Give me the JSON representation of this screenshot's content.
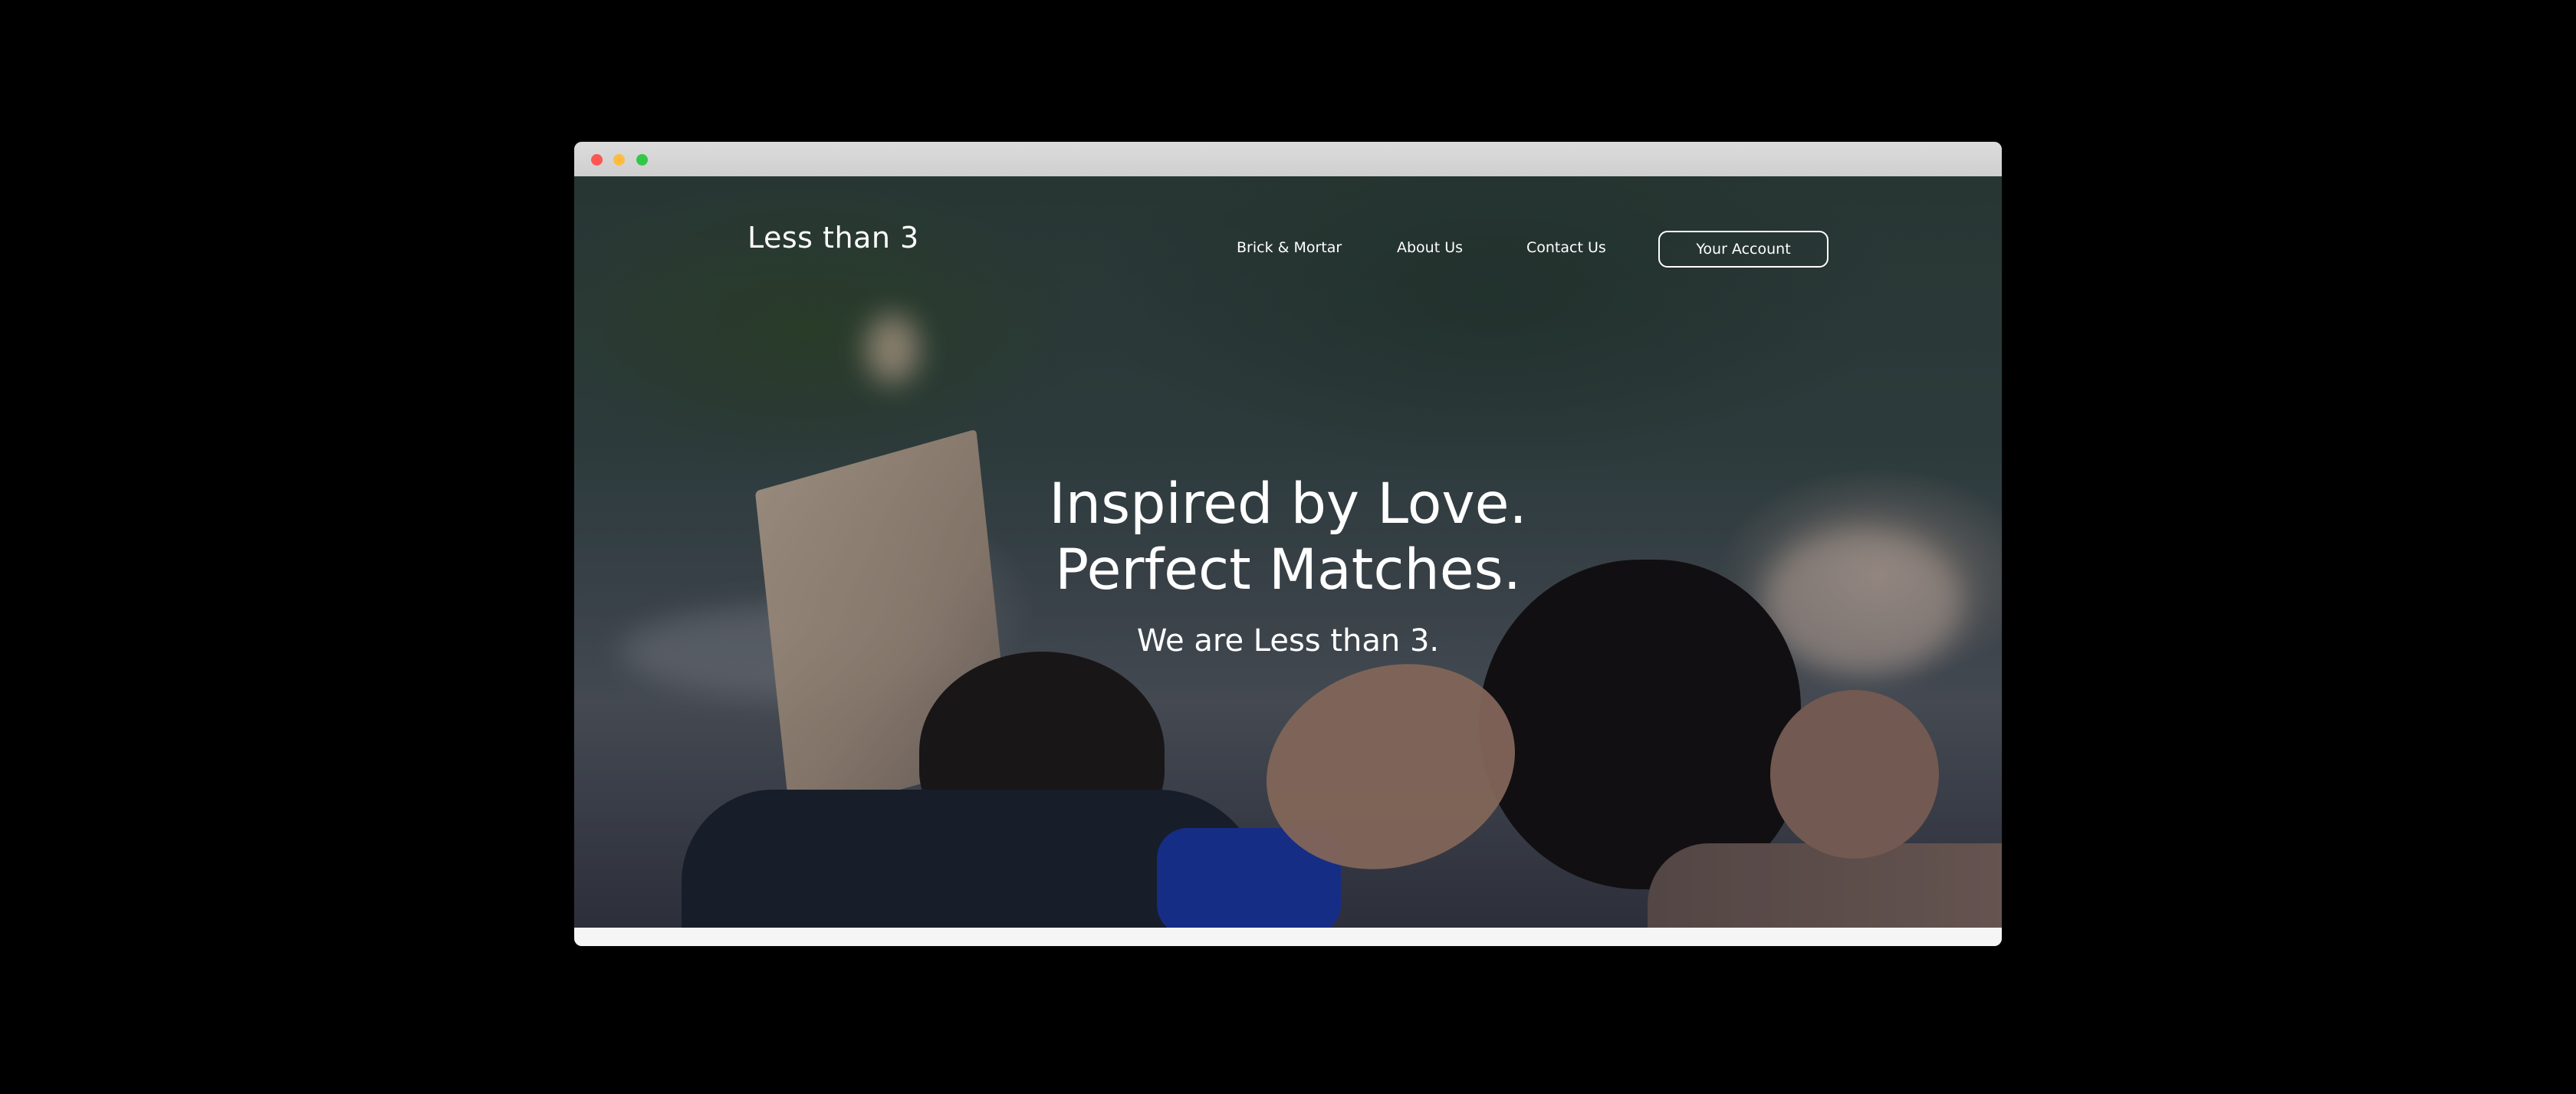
{
  "brand": {
    "name": "Less than 3"
  },
  "nav": {
    "links": [
      {
        "label": "Brick & Mortar"
      },
      {
        "label": "About Us"
      },
      {
        "label": "Contact Us"
      }
    ],
    "account_label": "Your Account"
  },
  "hero": {
    "headline_line1": "Inspired by Love.",
    "headline_line2": "Perfect Matches.",
    "subheadline": "We are Less than 3."
  },
  "window": {
    "controls": [
      "close",
      "minimize",
      "zoom"
    ]
  },
  "colors": {
    "backdrop": "#000000",
    "titlebar": "#d6d6d6",
    "close": "#fc5753",
    "minimize": "#fdbc40",
    "zoom": "#33c748",
    "text": "#ffffff"
  }
}
